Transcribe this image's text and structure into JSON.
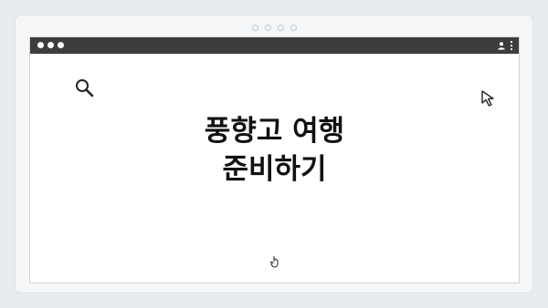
{
  "headline": {
    "line1": "풍향고 여행",
    "line2": "준비하기"
  },
  "icons": {
    "top": "pagination-dots",
    "window_controls": "traffic-light-dots",
    "profile": "profile-icon",
    "menu": "kebab-menu-icon",
    "search": "search-icon",
    "cursor": "cursor-icon",
    "hand": "pointing-hand-icon"
  },
  "colors": {
    "titlebar": "#3d3d3d",
    "background": "#e8ecf0",
    "window": "#ffffff",
    "text": "#111111"
  }
}
